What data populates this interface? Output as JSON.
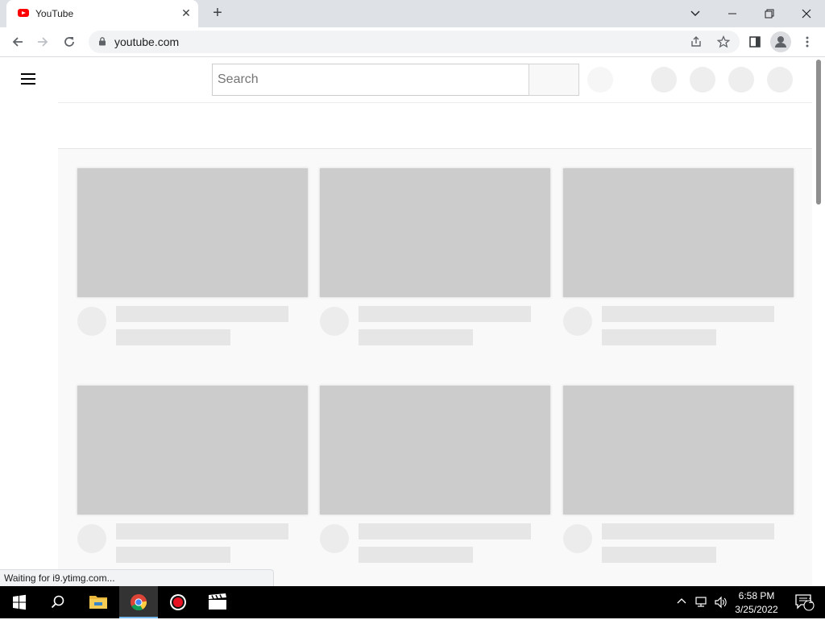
{
  "browser": {
    "tab": {
      "title": "YouTube",
      "close_glyph": "✕"
    },
    "new_tab_glyph": "+",
    "window_controls": {
      "tab_search_glyph": "⌄",
      "minimize_glyph": "—",
      "restore_glyph": "❐",
      "close_glyph": "✕"
    },
    "toolbar": {
      "back_glyph": "←",
      "forward_glyph": "→",
      "reload_glyph": "↻",
      "url": "youtube.com",
      "share_glyph": "⇪",
      "bookmark_glyph": "☆",
      "menu_glyph": "⋮"
    },
    "status_text": "Waiting for i9.ytimg.com..."
  },
  "youtube": {
    "search": {
      "placeholder": "Search",
      "value": ""
    },
    "loading_state": "skeleton",
    "video_grid": {
      "rows": 2,
      "columns": 3
    }
  },
  "taskbar": {
    "apps": [
      "start",
      "search",
      "file-explorer",
      "chrome",
      "recorder",
      "video-editor"
    ],
    "active_app": "chrome",
    "tray": {
      "chevron_glyph": "^",
      "time": "6:58 PM",
      "date": "3/25/2022",
      "notification_count": "1"
    }
  },
  "colors": {
    "youtube_red": "#ff0000",
    "skeleton_thumb": "#cccccc",
    "skeleton_text": "#e6e6e6",
    "taskbar": "#000000",
    "tabstrip": "#dee1e6"
  }
}
